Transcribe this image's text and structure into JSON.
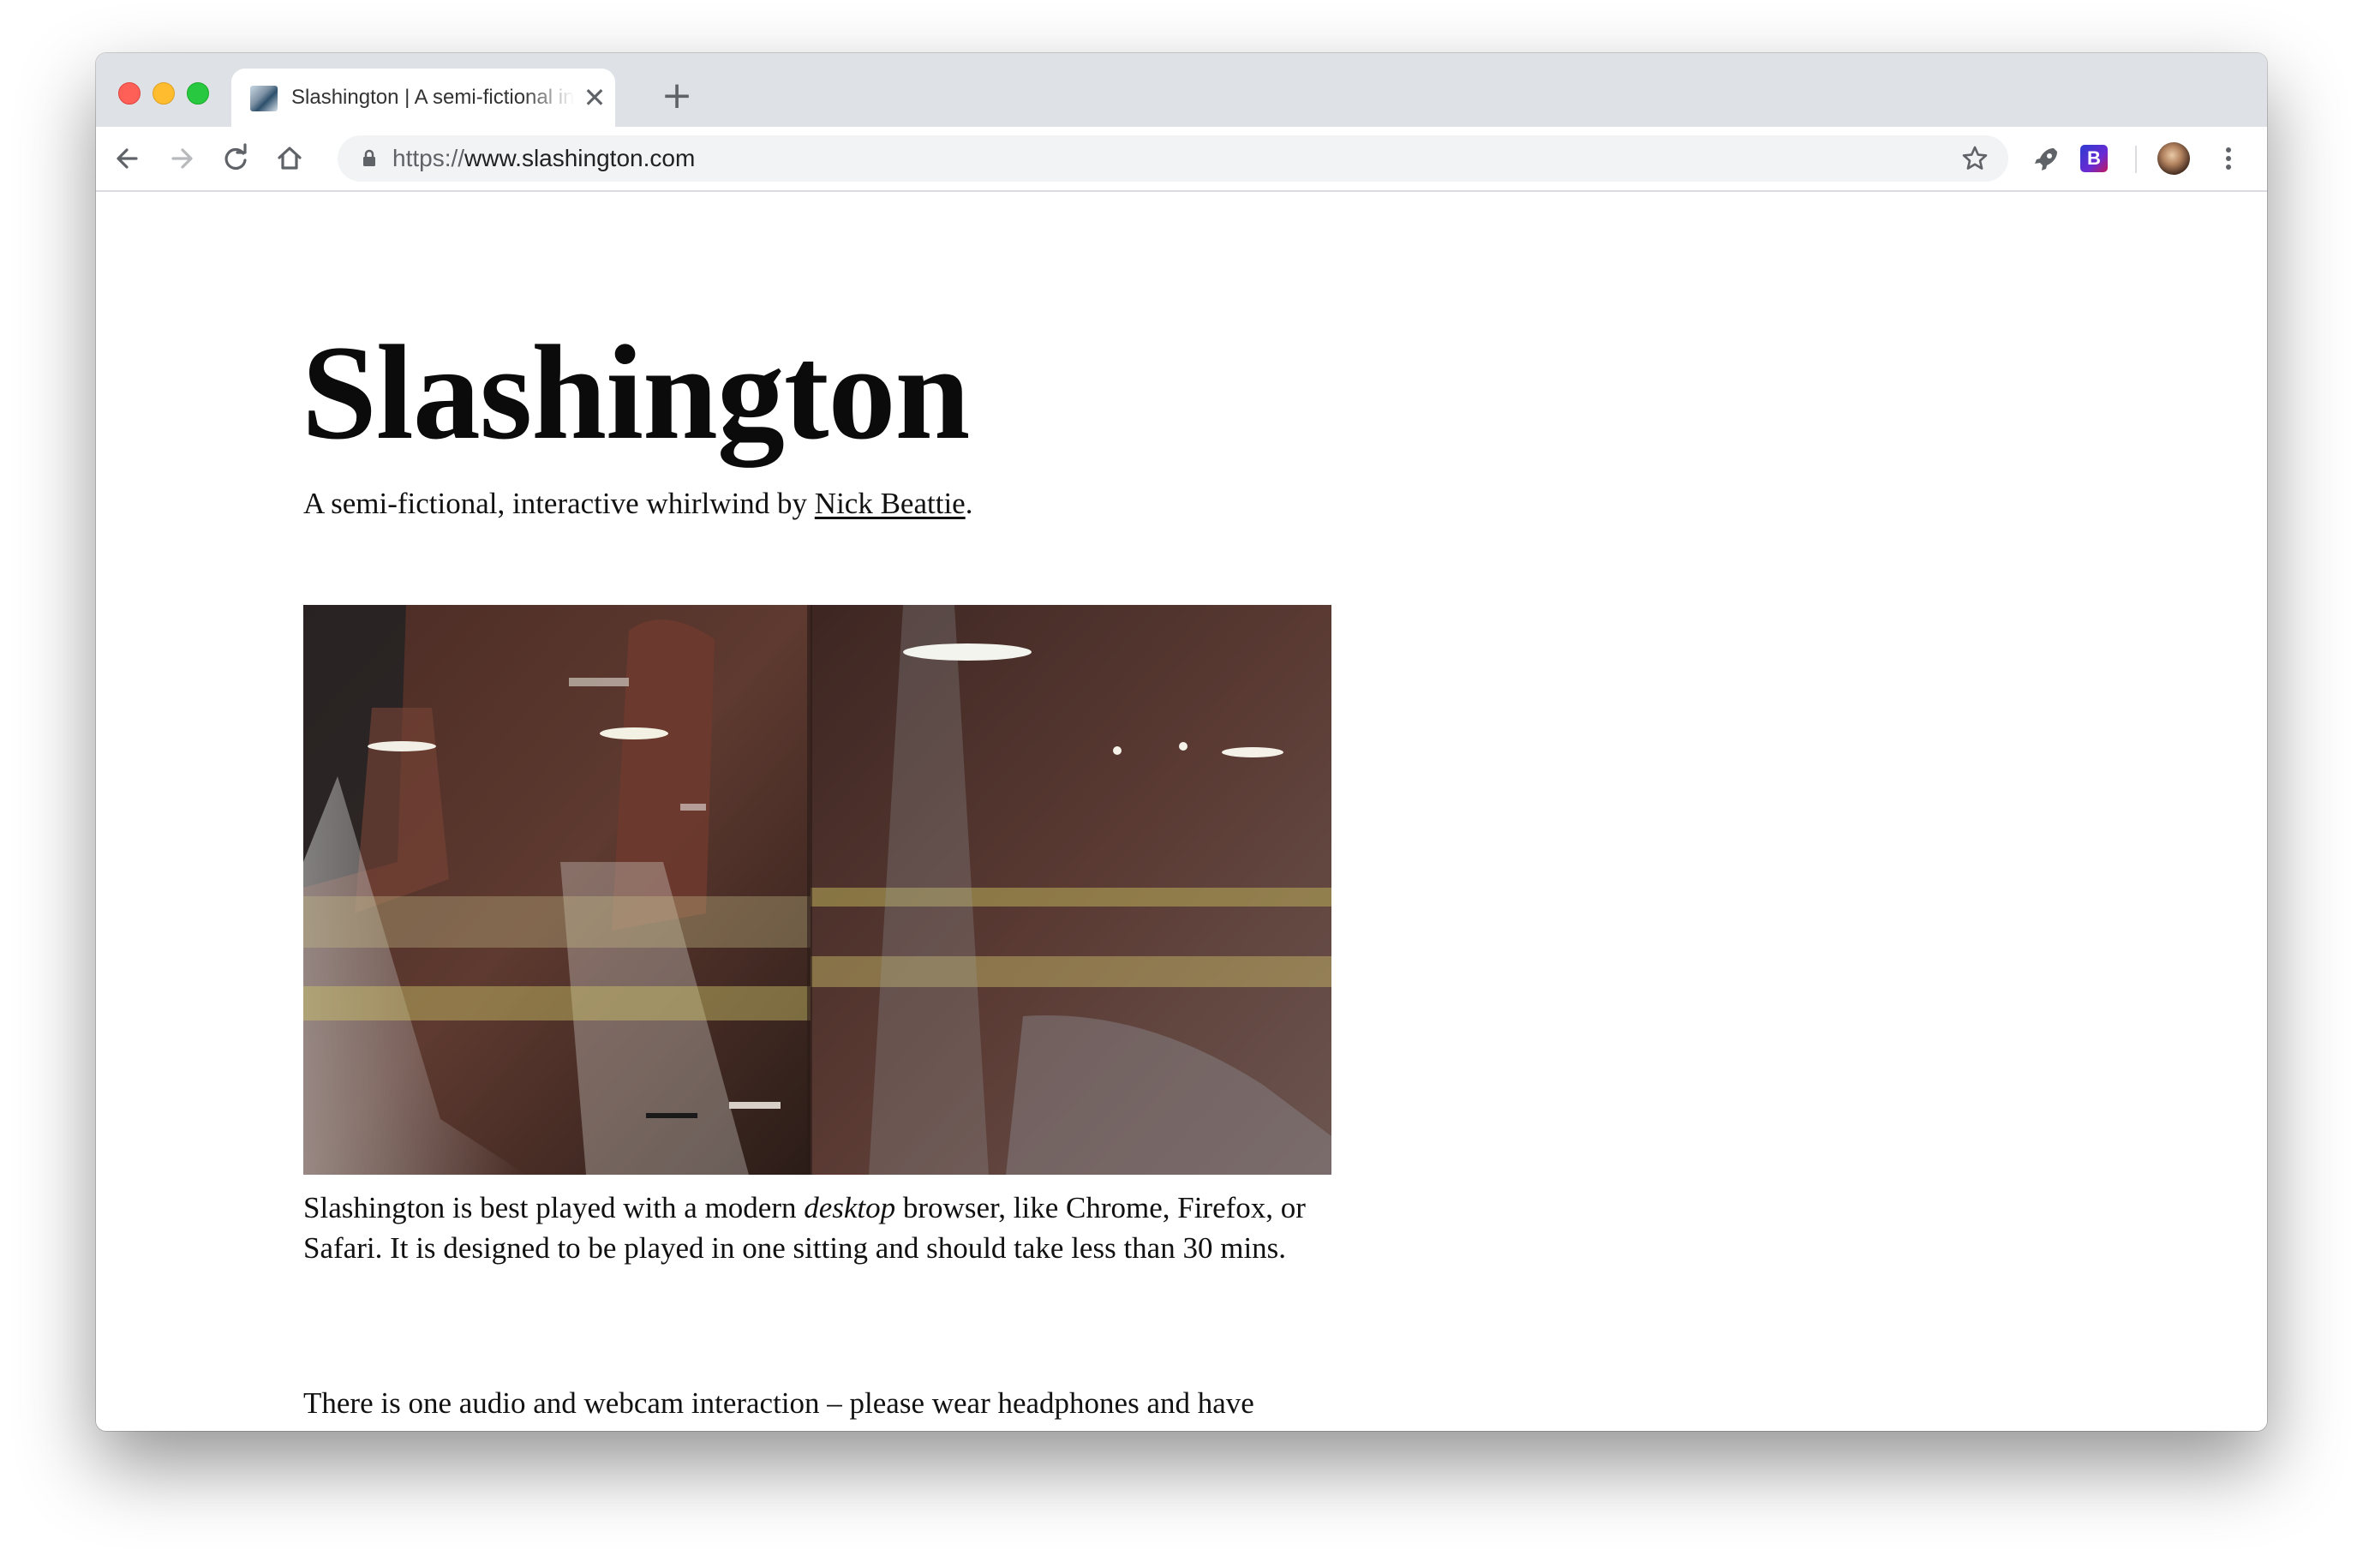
{
  "browser": {
    "tab": {
      "title": "Slashington | A semi-fictional interactive whirlwind",
      "close_glyph": "✕"
    },
    "new_tab_glyph": "+",
    "address_bar": {
      "scheme": "https://",
      "host": "www.slashington.com"
    },
    "extensions": {
      "b_label": "B"
    },
    "icons": [
      "back-icon",
      "forward-icon",
      "reload-icon",
      "home-icon",
      "lock-icon",
      "star-icon",
      "rocket-icon",
      "b-extension-icon",
      "avatar",
      "menu-icon"
    ]
  },
  "page": {
    "title": "Slashington",
    "subtitle_prefix": "A semi-fictional, interactive whirlwind by ",
    "author": "Nick Beattie",
    "subtitle_suffix": ".",
    "paragraph1_part1": "Slashington is best played with a modern ",
    "paragraph1_emphasis": "desktop",
    "paragraph1_part2": " browser, like Chrome, Firefox, or Safari. It is designed to be played in one sitting and should take less than 30 mins.",
    "paragraph2": "There is one audio and webcam interaction – please wear headphones and have"
  },
  "colors": {
    "titlebar": "#dee1e6",
    "omnibox": "#f1f3f4",
    "text": "#111111"
  }
}
